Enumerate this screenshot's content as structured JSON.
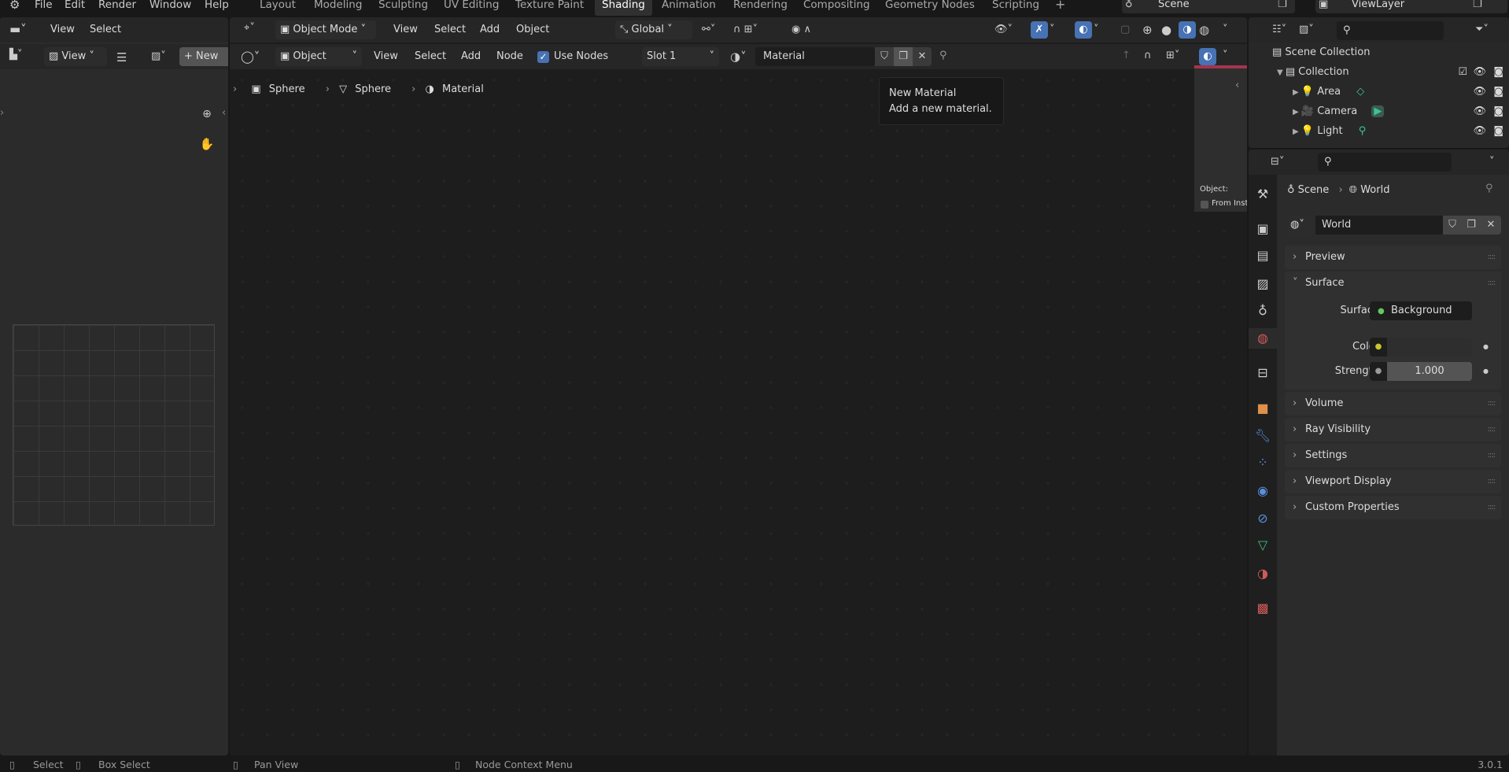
{
  "topbar": {
    "menus": [
      "File",
      "Edit",
      "Render",
      "Window",
      "Help"
    ],
    "workspaces": [
      "Layout",
      "Modeling",
      "Sculpting",
      "UV Editing",
      "Texture Paint",
      "Shading",
      "Animation",
      "Rendering",
      "Compositing",
      "Geometry Nodes",
      "Scripting"
    ],
    "active_workspace": "Shading",
    "add_workspace": "+",
    "scene": "Scene",
    "view_layer": "ViewLayer"
  },
  "file_browser_header": {
    "view": "View",
    "select": "Select"
  },
  "image_editor": {
    "view": "View",
    "new": "New"
  },
  "viewport_header": {
    "mode": "Object Mode",
    "menus": [
      "View",
      "Select",
      "Add",
      "Object"
    ],
    "orientation": "Global"
  },
  "node_header": {
    "type": "Object",
    "menus": [
      "View",
      "Select",
      "Add",
      "Node"
    ],
    "use_nodes_label": "Use Nodes",
    "use_nodes": true,
    "slot": "Slot 1",
    "material": "Material"
  },
  "breadcrumb": [
    "Sphere",
    "Sphere",
    "Material"
  ],
  "tooltip": {
    "title": "New Material",
    "description": "Add a new material."
  },
  "n_panel": {
    "object_label": "Object:",
    "from_instancer": "From Insta"
  },
  "outliner": {
    "scene_collection": "Scene Collection",
    "collection": "Collection",
    "items": [
      "Area",
      "Camera",
      "Light"
    ]
  },
  "properties": {
    "breadcrumb": [
      "Scene",
      "World"
    ],
    "world_name": "World",
    "panels": [
      "Preview",
      "Surface",
      "Volume",
      "Ray Visibility",
      "Settings",
      "Viewport Display",
      "Custom Properties"
    ],
    "surface_label": "Surface",
    "surface_value": "Background",
    "color_label": "Color",
    "strength_label": "Strength",
    "strength_value": "1.000",
    "colors": {
      "surface_socket": "#63c763",
      "color_socket": "#c7c729",
      "accent": "#4772b3"
    }
  },
  "status": {
    "select": "Select",
    "box_select": "Box Select",
    "pan_view": "Pan View",
    "context_menu": "Node Context Menu",
    "version": "3.0.1"
  }
}
